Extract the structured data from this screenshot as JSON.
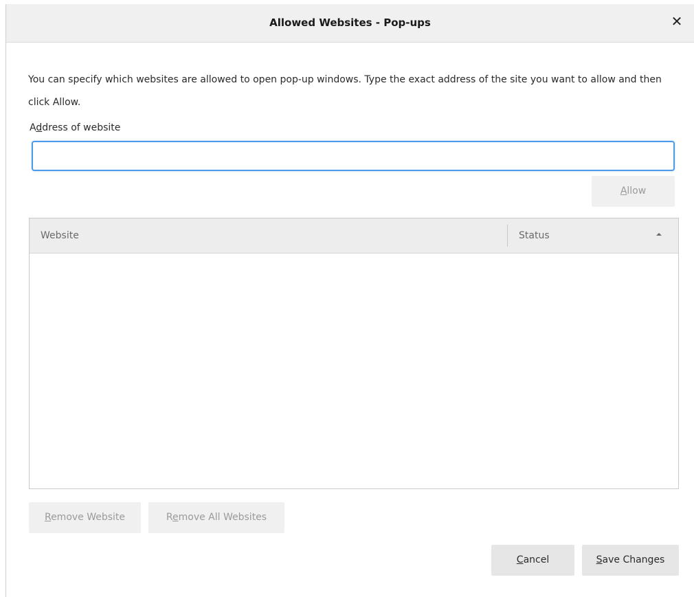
{
  "dialog": {
    "title": "Allowed Websites - Pop-ups",
    "close_glyph": "✕",
    "description": "You can specify which websites are allowed to open pop-up windows. Type the exact address of the site you want to allow and then click Allow.",
    "address_label": {
      "pre": "A",
      "key": "d",
      "post": "dress of website"
    },
    "address_value": "",
    "allow_button": {
      "pre": "",
      "key": "A",
      "post": "llow",
      "enabled": false
    },
    "table": {
      "columns": [
        {
          "label": "Website"
        },
        {
          "label": "Status",
          "sort": "ascending",
          "icon": "sort-ascending-icon"
        }
      ],
      "rows": []
    },
    "remove_website_button": {
      "pre": "",
      "key": "R",
      "post": "emove Website",
      "enabled": false
    },
    "remove_all_button": {
      "pre": "R",
      "key": "e",
      "post": "move All Websites",
      "enabled": false
    },
    "cancel_button": {
      "pre": "",
      "key": "C",
      "post": "ancel"
    },
    "save_button": {
      "pre": "",
      "key": "S",
      "post": "ave Changes"
    }
  },
  "colors": {
    "titlebar_bg": "#f0f0f0",
    "input_focus_border": "#4d9be8",
    "button_bg": "#e8e8e8",
    "disabled_text": "#9a9a9a"
  }
}
